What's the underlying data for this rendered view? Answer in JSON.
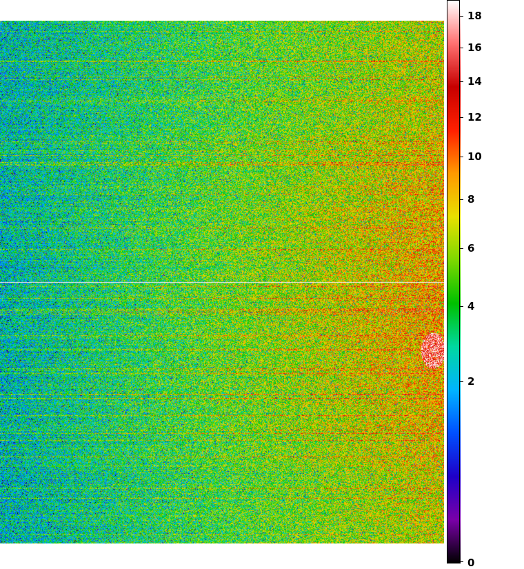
{
  "image": {
    "description_free": true,
    "colormap_stops": [
      "#000000",
      "#7a00a8",
      "#1f00c8",
      "#0050ff",
      "#00b4ff",
      "#00d8a0",
      "#00c000",
      "#7ed800",
      "#e8e000",
      "#ff9a00",
      "#ff2000",
      "#c80000",
      "#ff7070",
      "#ffffff"
    ]
  },
  "colorbar": {
    "ticks": [
      {
        "label": "18",
        "value": 18
      },
      {
        "label": "16",
        "value": 16
      },
      {
        "label": "14",
        "value": 14
      },
      {
        "label": "12",
        "value": 12
      },
      {
        "label": "10",
        "value": 10
      },
      {
        "label": "8",
        "value": 8
      },
      {
        "label": "6",
        "value": 6
      },
      {
        "label": "4",
        "value": 4
      },
      {
        "label": "2",
        "value": 2
      },
      {
        "label": "0",
        "value": 0
      }
    ],
    "range": [
      0,
      19
    ]
  }
}
